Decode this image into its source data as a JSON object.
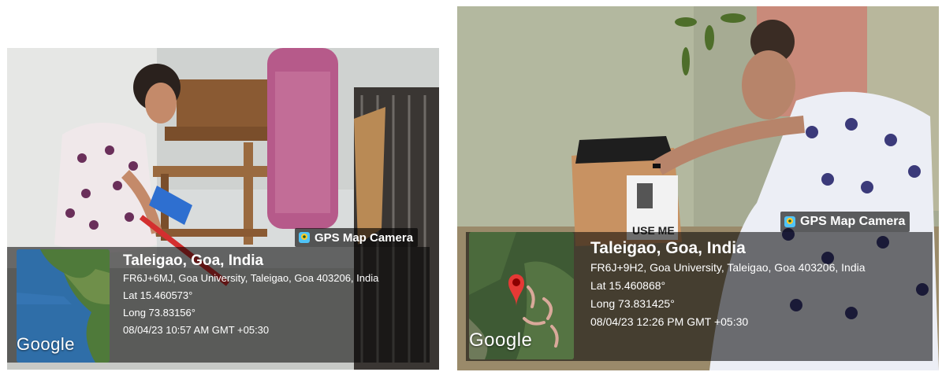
{
  "photos": [
    {
      "badge": "GPS Map Camera",
      "map_label": "Google",
      "location": "Taleigao, Goa, India",
      "address": "FR6J+6MJ, Goa University, Taleigao, Goa 403206, India",
      "lat": "Lat 15.460573°",
      "long": "Long 73.83156°",
      "timestamp": "08/04/23 10:57 AM GMT +05:30"
    },
    {
      "badge": "GPS Map Camera",
      "map_label": "Google",
      "location": "Taleigao, Goa, India",
      "address": "FR6J+9H2, Goa University, Taleigao, Goa 403206, India",
      "lat": "Lat 15.460868°",
      "long": "Long 73.831425°",
      "timestamp": "08/04/23 12:26 PM GMT +05:30",
      "bin_label": "USE ME"
    }
  ],
  "colors": {
    "pin": "#e53935",
    "overlay": "rgba(0,0,0,0.55)"
  }
}
